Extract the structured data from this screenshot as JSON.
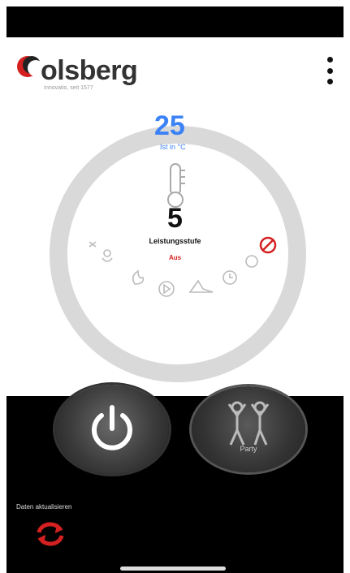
{
  "brand": {
    "name": "olsberg",
    "tagline": "Innovatio, seit 1577"
  },
  "temperature": {
    "value": "25",
    "unit_label": "Ist in °C"
  },
  "level": {
    "value": "5",
    "label": "Leistungsstufe",
    "status": "Aus"
  },
  "party": {
    "label": "Party"
  },
  "refresh": {
    "caption": "Daten aktualisieren"
  },
  "colors": {
    "accent_blue": "#3b82f6",
    "alert_red": "#d42020",
    "ring_gray": "#d9d9d9"
  },
  "icons": [
    "wifi-icon",
    "thermometer-icon",
    "menu-dots-icon",
    "power-icon",
    "party-people-icon",
    "refresh-icon",
    "no-entry-icon"
  ]
}
